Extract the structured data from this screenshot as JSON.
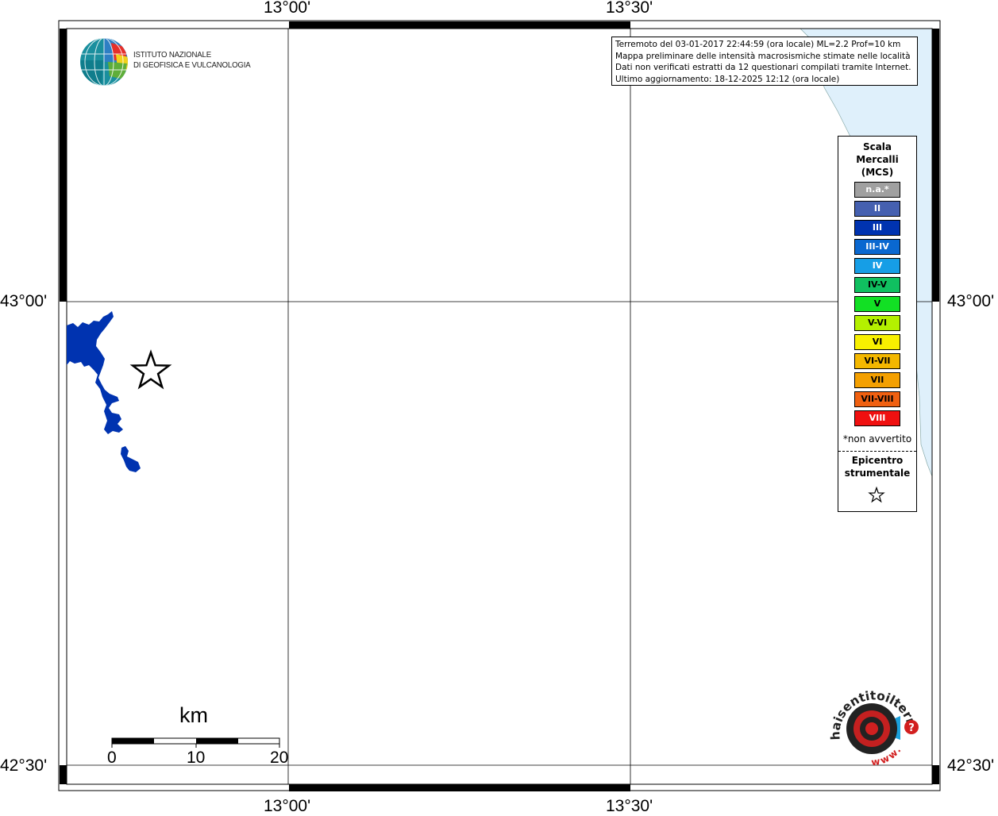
{
  "coordinates": {
    "lon_13_00": "13°00'",
    "lon_13_30": "13°30'",
    "lat_43_00": "43°00'",
    "lat_42_30": "42°30'"
  },
  "info": {
    "line1": "Terremoto del 03-01-2017 22:44:59 (ora locale) ML=2.2 Prof=10 km",
    "line2": "Mappa preliminare delle intensità macrosismiche stimate nelle località",
    "line3": "Dati non verificati estratti da 12 questionari compilati tramite Internet.",
    "line4": "Ultimo aggiornamento: 18-12-2025 12:12 (ora locale)"
  },
  "logo": {
    "line1": "ISTITUTO NAZIONALE",
    "line2": "DI GEOFISICA E VULCANOLOGIA"
  },
  "legend": {
    "title_line1": "Scala",
    "title_line2": "Mercalli",
    "title_line3": "(MCS)",
    "levels": [
      {
        "label": "n.a.*",
        "color": "#a0a0a0",
        "text_color": "#ffffff"
      },
      {
        "label": "II",
        "color": "#4560b0",
        "text_color": "#ffffff"
      },
      {
        "label": "III",
        "color": "#0033b0",
        "text_color": "#ffffff"
      },
      {
        "label": "III-IV",
        "color": "#0a68d0",
        "text_color": "#ffffff"
      },
      {
        "label": "IV",
        "color": "#169ee6",
        "text_color": "#ffffff"
      },
      {
        "label": "IV-V",
        "color": "#10c060",
        "text_color": "#000000"
      },
      {
        "label": "V",
        "color": "#12e024",
        "text_color": "#000000"
      },
      {
        "label": "V-VI",
        "color": "#b4f000",
        "text_color": "#000000"
      },
      {
        "label": "VI",
        "color": "#f8f000",
        "text_color": "#000000"
      },
      {
        "label": "VI-VII",
        "color": "#f4b800",
        "text_color": "#000000"
      },
      {
        "label": "VII",
        "color": "#f4a000",
        "text_color": "#000000"
      },
      {
        "label": "VII-VIII",
        "color": "#f06010",
        "text_color": "#000000"
      },
      {
        "label": "VIII",
        "color": "#f01010",
        "text_color": "#ffffff"
      }
    ],
    "note": "*non avvertito",
    "epicenter_line1": "Epicentro",
    "epicenter_line2": "strumentale"
  },
  "scalebar": {
    "unit": "km",
    "ticks": [
      "0",
      "10",
      "20"
    ]
  },
  "colors": {
    "lake": "#0033b0",
    "sea": "#dff0fb"
  },
  "hst_logo": {
    "text_main": "haisentitoilterremoto.it",
    "text_www": "www."
  }
}
